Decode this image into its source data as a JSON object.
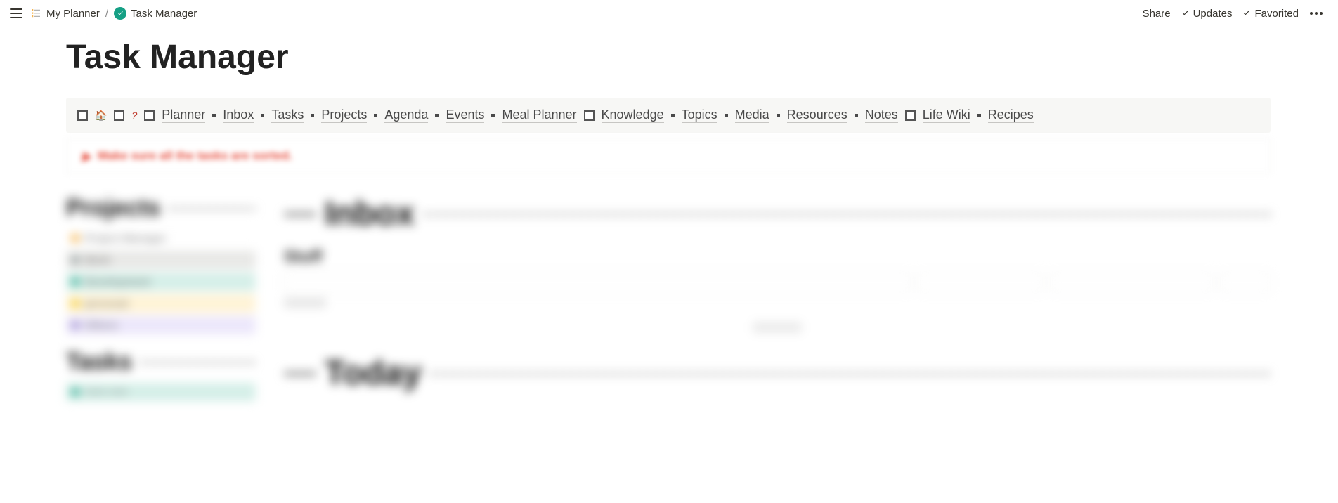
{
  "breadcrumb": {
    "parent": "My Planner",
    "current": "Task Manager"
  },
  "topbar": {
    "share": "Share",
    "updates": "Updates",
    "favorited": "Favorited"
  },
  "page": {
    "title": "Task Manager"
  },
  "nav": {
    "items": [
      "Planner",
      "Inbox",
      "Tasks",
      "Projects",
      "Agenda",
      "Events",
      "Meal Planner",
      "Knowledge",
      "Topics",
      "Media",
      "Resources",
      "Notes",
      "Life Wiki",
      "Recipes"
    ]
  },
  "callout": {
    "text": "Make sure all the tasks are sorted."
  },
  "side": {
    "heading1": "Projects",
    "heading2": "Tasks",
    "items": [
      {
        "label": "Project Manager",
        "color": "#ffffff",
        "dot": "#f39c12"
      },
      {
        "label": "Work",
        "color": "#e8e8e6",
        "dot": "#7f8c8d"
      },
      {
        "label": "Development",
        "color": "#d5efe8",
        "dot": "#16a085"
      },
      {
        "label": "personal",
        "color": "#fff3d6",
        "dot": "#f1c40f"
      },
      {
        "label": "Others",
        "color": "#ece7fb",
        "dot": "#8e7cc3"
      }
    ]
  },
  "main": {
    "heading1": "Inbox",
    "subheading": "Stuff",
    "heading2": "Today"
  }
}
